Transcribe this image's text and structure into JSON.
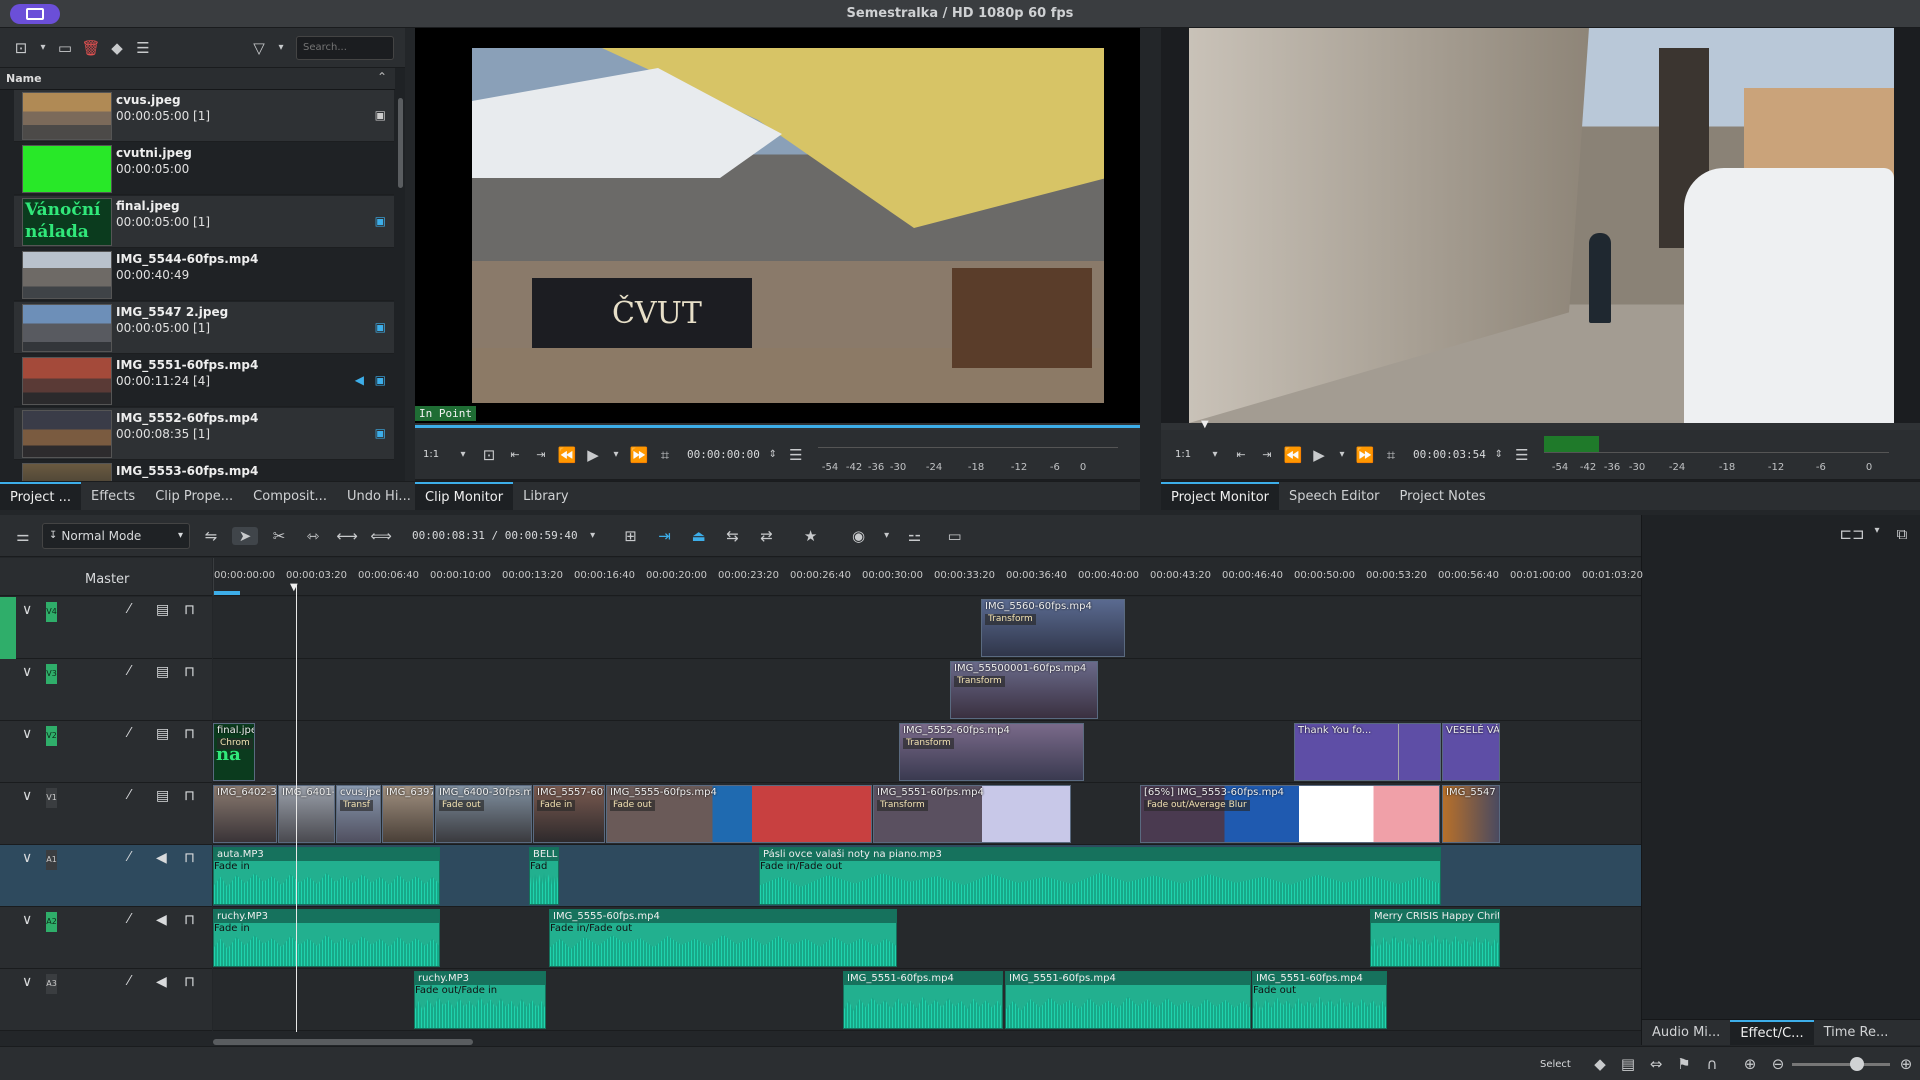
{
  "window": {
    "title": "Semestralka / HD 1080p 60 fps"
  },
  "bin": {
    "search_placeholder": "Search...",
    "column_header": "Name",
    "items": [
      {
        "name": "cvus.jpeg",
        "duration": "00:00:05:00 [1]"
      },
      {
        "name": "cvutni.jpeg",
        "duration": "00:00:05:00"
      },
      {
        "name": "final.jpeg",
        "duration": "00:00:05:00 [1]",
        "thumb_text": "Vánoční nálada"
      },
      {
        "name": "IMG_5544-60fps.mp4",
        "duration": "00:00:40:49"
      },
      {
        "name": "IMG_5547 2.jpeg",
        "duration": "00:00:05:00 [1]"
      },
      {
        "name": "IMG_5551-60fps.mp4",
        "duration": "00:00:11:24 [4]"
      },
      {
        "name": "IMG_5552-60fps.mp4",
        "duration": "00:00:08:35 [1]"
      },
      {
        "name": "IMG_5553-60fps.mp4",
        "duration": ""
      }
    ],
    "tabs": [
      "Project ...",
      "Effects",
      "Clip Prope...",
      "Composit...",
      "Undo Hi..."
    ]
  },
  "clip_monitor": {
    "overlay": "In Point",
    "zoom": "1:1",
    "timecode": "00:00:00:00",
    "image_text": "ČVUT",
    "tabs": [
      "Clip Monitor",
      "Library"
    ]
  },
  "project_monitor": {
    "zoom": "1:1",
    "timecode": "00:00:03:54",
    "tabs": [
      "Project Monitor",
      "Speech Editor",
      "Project Notes"
    ],
    "meter_labels": [
      "-54",
      "-42",
      "-36",
      "-30",
      "-24",
      "-18",
      "-12",
      "-6",
      "0"
    ]
  },
  "clip_meter_labels": [
    "-54",
    "-42",
    "-36",
    "-30",
    "-24",
    "-18",
    "-12",
    "-6",
    "0"
  ],
  "timeline_toolbar": {
    "mode": "Normal Mode",
    "position": "00:00:08:31 / 00:00:59:40"
  },
  "timeline": {
    "master_label": "Master",
    "ruler": [
      "00:00:00:00",
      "00:00:03:20",
      "00:00:06:40",
      "00:00:10:00",
      "00:00:13:20",
      "00:00:16:40",
      "00:00:20:00",
      "00:00:23:20",
      "00:00:26:40",
      "00:00:30:00",
      "00:00:33:20",
      "00:00:36:40",
      "00:00:40:00",
      "00:00:43:20",
      "00:00:46:40",
      "00:00:50:00",
      "00:00:53:20",
      "00:00:56:40",
      "00:01:00:00",
      "00:01:03:20"
    ],
    "tracks": [
      {
        "tag": "V4",
        "clips": [
          {
            "name": "IMG_5560-60fps.mp4",
            "effect": "Transform"
          }
        ]
      },
      {
        "tag": "V3",
        "clips": [
          {
            "name": "IMG_55500001-60fps.mp4",
            "effect": "Transform"
          }
        ]
      },
      {
        "tag": "V2",
        "clips": [
          {
            "name": "final.jpeg",
            "effect": "Chrom",
            "thumb": "na"
          },
          {
            "name": "IMG_5552-60fps.mp4",
            "effect": "Transform"
          },
          {
            "name": "Thank You fo...",
            "effect": ""
          },
          {
            "name": "VESELÉ VÁN",
            "effect": ""
          }
        ]
      },
      {
        "tag": "V1",
        "clips": [
          {
            "name": "IMG_6402-3",
            "effect": ""
          },
          {
            "name": "IMG_6401-",
            "effect": ""
          },
          {
            "name": "cvus.jpeg",
            "effect": "Transf"
          },
          {
            "name": "IMG_6397",
            "effect": ""
          },
          {
            "name": "IMG_6400-30fps.mp",
            "effect": "Fade out"
          },
          {
            "name": "IMG_5557-60f",
            "effect": "Fade in"
          },
          {
            "name": "IMG_5555-60fps.mp4",
            "effect": "Fade out"
          },
          {
            "name": "IMG_5551-60fps.mp4",
            "effect": "Transform"
          },
          {
            "name": "[65%] IMG_5553-60fps.mp4",
            "effect": "Fade out/Average Blur"
          },
          {
            "name": "IMG_5547 2",
            "effect": ""
          }
        ]
      },
      {
        "tag": "A1",
        "clips": [
          {
            "name": "auta.MP3",
            "effect": "Fade in"
          },
          {
            "name": "BELLH",
            "effect": "Fad"
          },
          {
            "name": "Pásli ovce valaši  noty na piano.mp3",
            "effect": "Fade in/Fade out"
          }
        ]
      },
      {
        "tag": "A2",
        "clips": [
          {
            "name": "ruchy.MP3",
            "effect": "Fade in"
          },
          {
            "name": "IMG_5555-60fps.mp4",
            "effect": "Fade in/Fade out"
          },
          {
            "name": "Merry CRISIS Happy Chrithr",
            "effect": ""
          }
        ]
      },
      {
        "tag": "A3",
        "clips": [
          {
            "name": "ruchy.MP3",
            "effect": "Fade out/Fade in"
          },
          {
            "name": "IMG_5551-60fps.mp4",
            "effect": ""
          },
          {
            "name": "IMG_5551-60fps.mp4",
            "effect": ""
          },
          {
            "name": "IMG_5551-60fps.mp4",
            "effect": "Fade out"
          }
        ]
      }
    ]
  },
  "right_panel_tabs": [
    "Audio Mi...",
    "Effect/C...",
    "Time Re..."
  ],
  "status_bar": {
    "tool": "Select"
  },
  "colors": {
    "accent": "#3daee9",
    "audio": "#22b08f",
    "track_tag": "#2fae6a"
  }
}
